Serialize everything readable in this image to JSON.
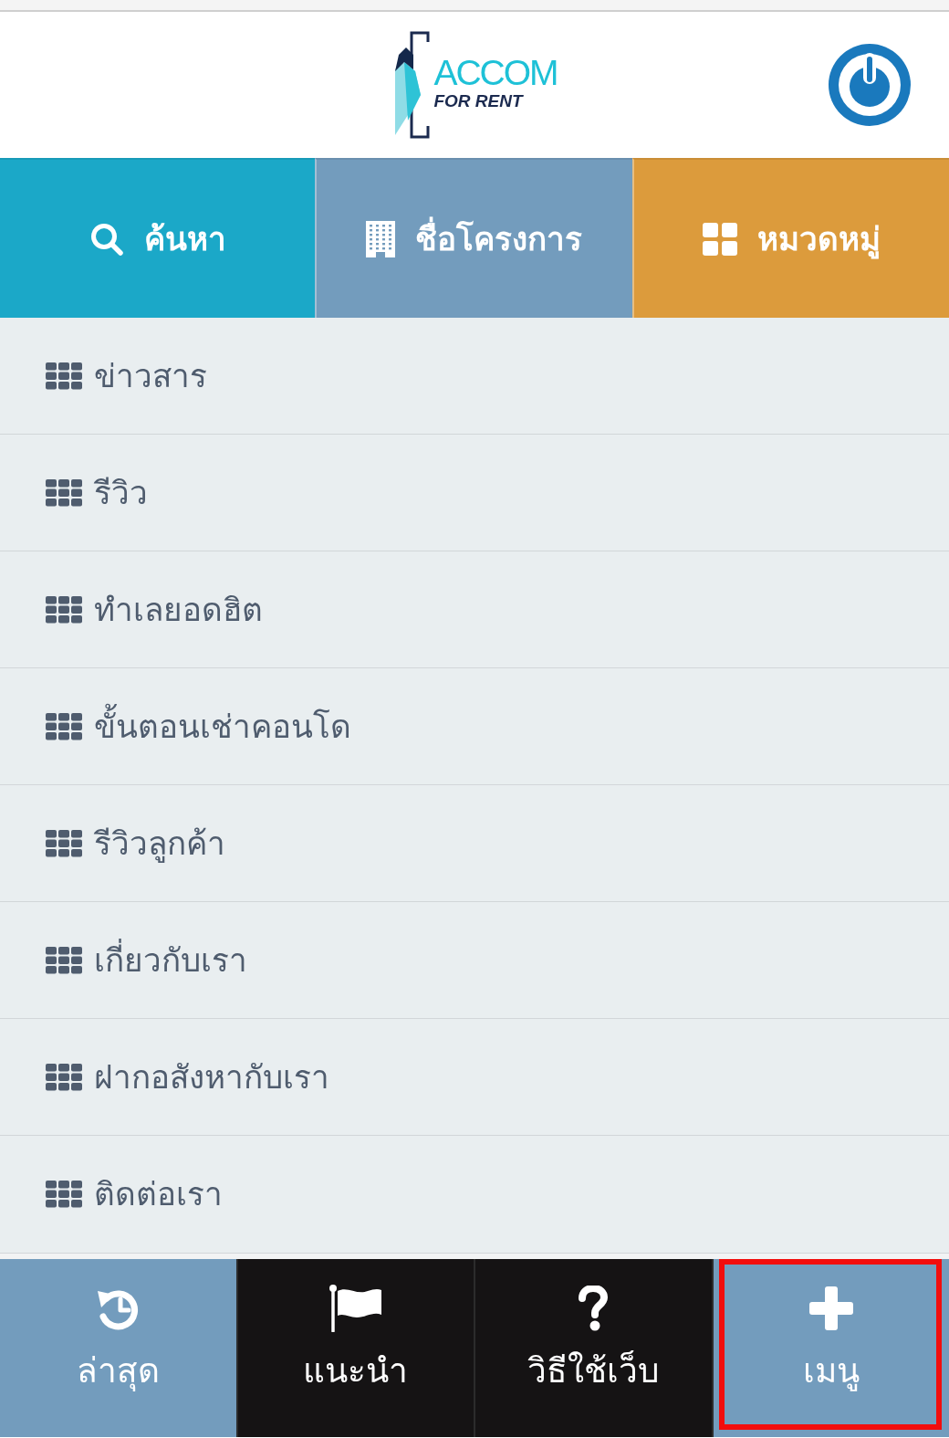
{
  "header": {
    "logo": {
      "name": "ACCOM",
      "tagline": "FOR RENT"
    }
  },
  "category_buttons": [
    {
      "label": "ค้นหา",
      "color": "#1ba8c8"
    },
    {
      "label": "ชื่อโครงการ",
      "color": "#739cbd"
    },
    {
      "label": "หมวดหมู่",
      "color": "#dc9b3c"
    }
  ],
  "menu_items": [
    "ข่าวสาร",
    "รีวิว",
    "ทำเลยอดฮิต",
    "ขั้นตอนเช่าคอนโด",
    "รีวิวลูกค้า",
    "เกี่ยวกับเรา",
    "ฝากอสังหากับเรา",
    "ติดต่อเรา"
  ],
  "bottom_nav": [
    {
      "label": "ล่าสุด",
      "color": "#739cbd",
      "highlighted": false
    },
    {
      "label": "แนะนำ",
      "color": "#151314",
      "highlighted": false
    },
    {
      "label": "วิธีใช้เว็บ",
      "color": "#151314",
      "highlighted": false
    },
    {
      "label": "เมนู",
      "color": "#739cbd",
      "highlighted": true
    }
  ]
}
